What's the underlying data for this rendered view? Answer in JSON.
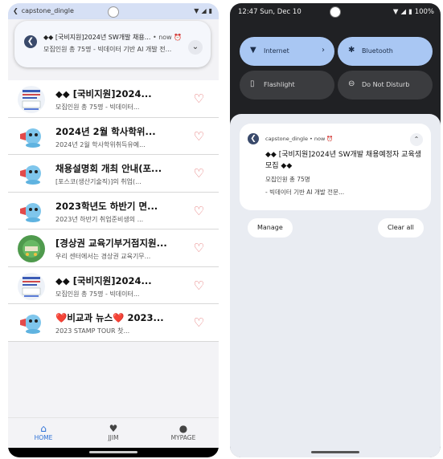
{
  "left": {
    "status": {
      "app": "capstone_dingle"
    },
    "heads_up": {
      "title": "◆◆ [국비지원]2024년 SW개발 채용...",
      "meta": "• now ⏰",
      "body": "모집인원 총 75명 - 빅데이터 기반 AI 개발 전..."
    },
    "list": [
      {
        "title": "◆◆ [국비지원]2024...",
        "sub": "모집인원 총 75명 - 빅데이터...",
        "thumb": "poster"
      },
      {
        "title": "2024년 2월 학사학위...",
        "sub": "2024년 2월 학사학위취득유예...",
        "thumb": "mascot"
      },
      {
        "title": "채용설명회 개최 안내(포...",
        "sub": "[포스코(생산기술직)]의 취업(...",
        "thumb": "mascot"
      },
      {
        "title": "2023학년도 하반기 면...",
        "sub": "2023년 하반기 취업준비생의 ...",
        "thumb": "mascot"
      },
      {
        "title": "[경상권 교육기부거점지원...",
        "sub": "우리 센터에서는 경상권 교육기무...",
        "thumb": "green"
      },
      {
        "title": "◆◆ [국비지원]2024...",
        "sub": "모집인원 총 75명 - 빅데이터...",
        "thumb": "poster"
      },
      {
        "title": "❤️비교과 뉴스❤️ 2023...",
        "sub": "2023 STAMP TOUR 찻...",
        "thumb": "mascot"
      }
    ],
    "tabs": [
      {
        "label": "HOME",
        "icon": "home-icon"
      },
      {
        "label": "JJIM",
        "icon": "heart-icon"
      },
      {
        "label": "MYPAGE",
        "icon": "person-icon"
      }
    ]
  },
  "right": {
    "status": {
      "time": "12:47 Sun, Dec 10",
      "battery": "100%"
    },
    "quick_settings": [
      {
        "label": "Internet",
        "icon": "wifi-icon",
        "state": "on"
      },
      {
        "label": "Bluetooth",
        "icon": "bluetooth-icon",
        "state": "on"
      },
      {
        "label": "Flashlight",
        "icon": "flashlight-icon",
        "state": "off"
      },
      {
        "label": "Do Not Disturb",
        "icon": "dnd-icon",
        "state": "off"
      }
    ],
    "notification": {
      "app_line": "capstone_dingle • now ⏰",
      "title": "◆◆ [국비지원]2024년 SW개발 채용예정자 교육생 모집 ◆◆",
      "body1": "모집인원 총 75명",
      "body2": "- 빅데이터 기반 AI 개발 전문..."
    },
    "manage_label": "Manage",
    "clear_label": "Clear all"
  },
  "colors": {
    "accent": "#2a6fd6",
    "heart": "#e36b6b",
    "qs_on": "#a9c7f3",
    "qs_off": "#3b3c3f"
  }
}
